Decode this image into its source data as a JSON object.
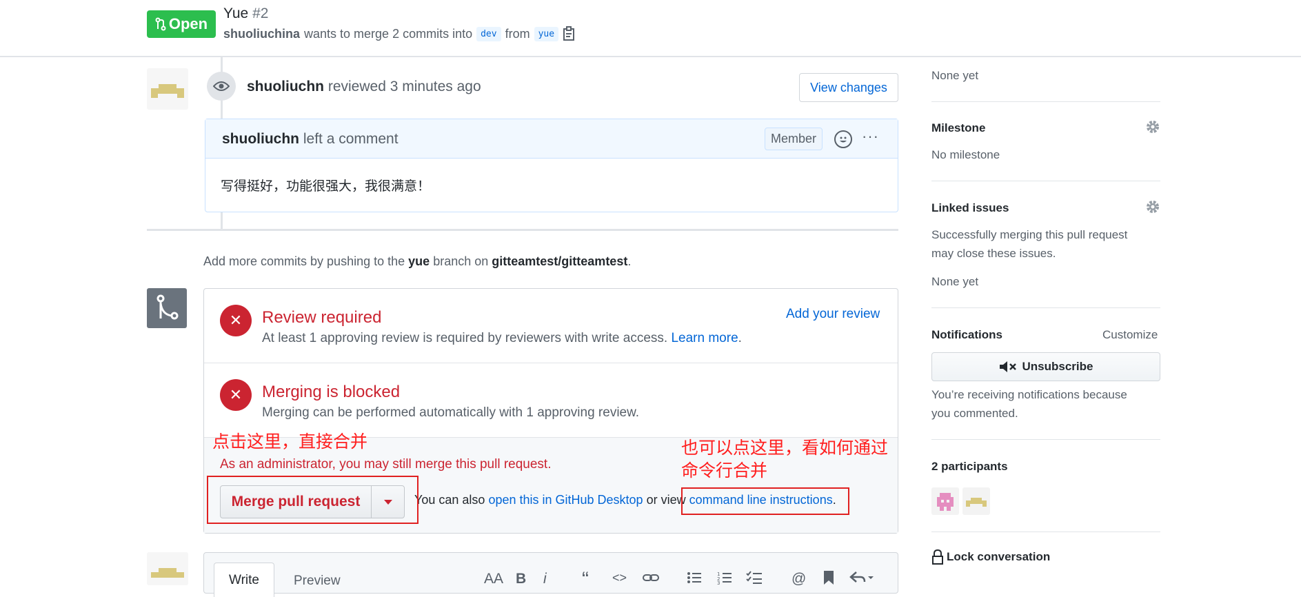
{
  "header": {
    "state_label": "Open",
    "title": "Yue",
    "number": "#2",
    "author": "shuoliuchina",
    "merge_text": "wants to merge 2 commits into",
    "base_branch": "dev",
    "from_text": "from",
    "head_branch": "yue"
  },
  "review": {
    "reviewer": "shuoliuchn",
    "action": "reviewed",
    "time": "3 minutes ago",
    "view_changes_label": "View changes"
  },
  "comment": {
    "author": "shuoliuchn",
    "action": "left a comment",
    "badge": "Member",
    "more": "···",
    "body": "写得挺好，功能很强大，我很满意！"
  },
  "push_hint": {
    "prefix": "Add more commits by pushing to the",
    "branch": "yue",
    "middle": "branch on",
    "repo": "gitteamtest/gitteamtest",
    "suffix": "."
  },
  "merge_box": {
    "review_required": {
      "title": "Review required",
      "desc": "At least 1 approving review is required by reviewers with write access.",
      "learn_more": "Learn more",
      "period": ".",
      "add_review": "Add your review"
    },
    "merging_blocked": {
      "title": "Merging is blocked",
      "desc": "Merging can be performed automatically with 1 approving review."
    },
    "admin_note": "As an administrator, you may still merge this pull request.",
    "merge_button": "Merge pull request",
    "also_prefix": "You can also",
    "desktop_link": "open this in GitHub Desktop",
    "or_view": "or view",
    "cli_link": "command line instructions",
    "period": "."
  },
  "annotations": {
    "click_here": "点击这里，直接合并",
    "cli_note_line1": "也可以点这里，看如何通过",
    "cli_note_line2": "命令行合并",
    "color": "#ff1f1f"
  },
  "composer": {
    "write_tab": "Write",
    "preview_tab": "Preview",
    "tools": [
      "AA",
      "B",
      "i",
      "“",
      "<>",
      "link-icon",
      "bulleted-list-icon",
      "numbered-list-icon",
      "task-list-icon",
      "@",
      "bookmark-icon",
      "reply-icon"
    ]
  },
  "sidebar": {
    "none_yet_top": "None yet",
    "milestone_heading": "Milestone",
    "milestone_value": "No milestone",
    "linked_heading": "Linked issues",
    "linked_desc_1": "Successfully merging this pull request",
    "linked_desc_2": "may close these issues.",
    "linked_value": "None yet",
    "notifications_heading": "Notifications",
    "customize": "Customize",
    "unsubscribe": "Unsubscribe",
    "notify_desc_1": "You’re receiving notifications because",
    "notify_desc_2": "you commented.",
    "participants": "2 participants",
    "lock": "Lock conversation"
  },
  "colors": {
    "open_green": "#2cbe4e",
    "error_red": "#cb2431",
    "link_blue": "#0366d6"
  }
}
